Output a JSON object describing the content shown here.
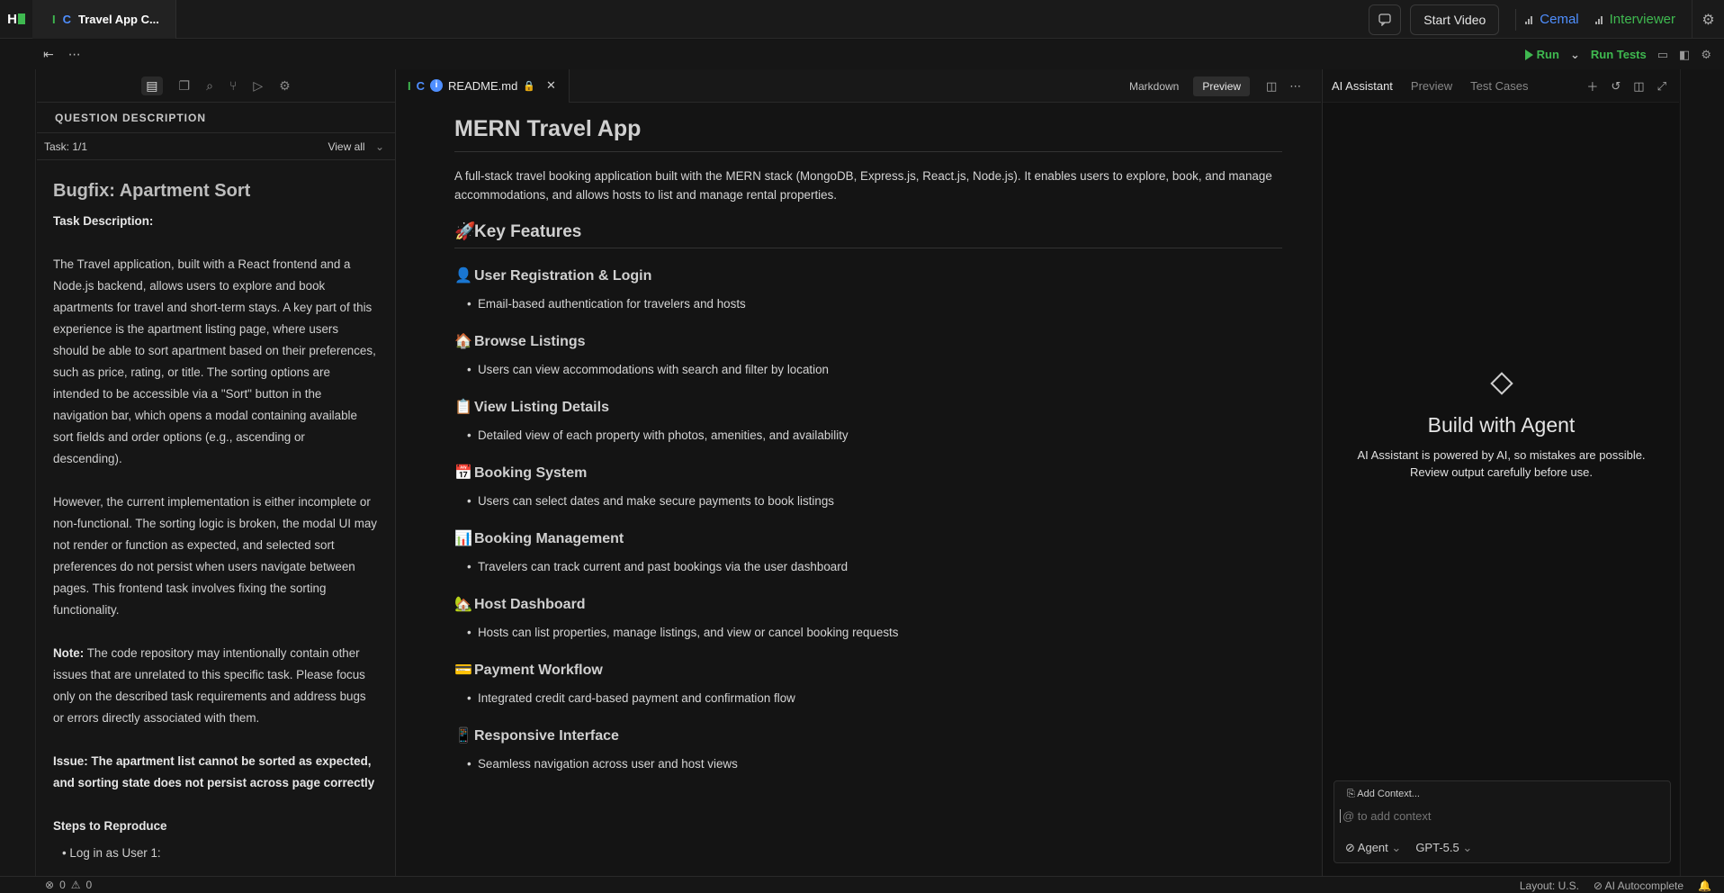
{
  "topbar": {
    "logo": "H",
    "tab_title": "Travel App C...",
    "tab_icon_i": "I",
    "tab_icon_c": "C",
    "chat_icon": "chat-bubble-icon",
    "start_video": "Start Video",
    "users": [
      {
        "name": "Cemal",
        "color": "#4f8fff"
      },
      {
        "name": "Interviewer",
        "color": "#3fb950"
      }
    ]
  },
  "subbar": {
    "run": "Run",
    "run_tests": "Run Tests"
  },
  "left": {
    "section_title": "QUESTION DESCRIPTION",
    "task": "Task: 1/1",
    "view_all": "View all",
    "title": "Bugfix: Apartment Sort",
    "task_desc_label": "Task Description:",
    "p1": "The Travel application, built with a React frontend and a Node.js backend, allows users to explore and book apartments for travel and short-term stays. A key part of this experience is the apartment listing page, where users should be able to sort apartment based on their preferences, such as price, rating, or title. The sorting options are intended to be accessible via a \"Sort\" button in the navigation bar, which opens a modal containing available sort fields and order options (e.g., ascending or descending).",
    "p2": "However, the current implementation is either incomplete or non-functional. The sorting logic is broken, the modal UI may not render or function as expected, and selected sort preferences do not persist when users navigate between pages. This frontend task involves fixing the sorting functionality.",
    "note_label": "Note:",
    "note": " The code repository may intentionally contain other issues that are unrelated to this specific task. Please focus only on the described task requirements and address bugs or errors directly associated with them.",
    "issue": "Issue: The apartment list cannot be sorted as expected, and sorting state does not persist across page correctly",
    "steps_label": "Steps to Reproduce",
    "step1": "Log in as User 1:"
  },
  "editor": {
    "tab_i": "I",
    "tab_c": "C",
    "tab_info": "i",
    "tab_name": "README.md",
    "mode_markdown": "Markdown",
    "mode_preview": "Preview",
    "h1": "MERN Travel App",
    "lead": "A full-stack travel booking application built with the MERN stack (MongoDB, Express.js, React.js, Node.js). It enables users to explore, book, and manage accommodations, and allows hosts to list and manage rental properties.",
    "features_title": "Key Features",
    "features_emoji": "🚀",
    "features": [
      {
        "emoji": "👤",
        "title": "User Registration & Login",
        "item": "Email-based authentication for travelers and hosts"
      },
      {
        "emoji": "🏠",
        "title": "Browse Listings",
        "item": "Users can view accommodations with search and filter by location"
      },
      {
        "emoji": "📋",
        "title": "View Listing Details",
        "item": "Detailed view of each property with photos, amenities, and availability"
      },
      {
        "emoji": "📅",
        "title": "Booking System",
        "item": "Users can select dates and make secure payments to book listings"
      },
      {
        "emoji": "📊",
        "title": "Booking Management",
        "item": "Travelers can track current and past bookings via the user dashboard"
      },
      {
        "emoji": "🏡",
        "title": "Host Dashboard",
        "item": "Hosts can list properties, manage listings, and view or cancel booking requests"
      },
      {
        "emoji": "💳",
        "title": "Payment Workflow",
        "item": "Integrated credit card-based payment and confirmation flow"
      },
      {
        "emoji": "📱",
        "title": "Responsive Interface",
        "item": "Seamless navigation across user and host views"
      }
    ]
  },
  "right": {
    "tabs": [
      "AI Assistant",
      "Preview",
      "Test Cases"
    ],
    "heading": "Build with Agent",
    "line1": "AI Assistant is powered by AI, so mistakes are possible.",
    "line2": "Review output carefully before use.",
    "add_context": "Add Context...",
    "input_placeholder": "@ to add context",
    "agent": "Agent",
    "model": "GPT-5.5"
  },
  "status": {
    "errors": "0",
    "warnings": "0",
    "layout": "Layout: U.S.",
    "autocomplete": "AI Autocomplete"
  }
}
